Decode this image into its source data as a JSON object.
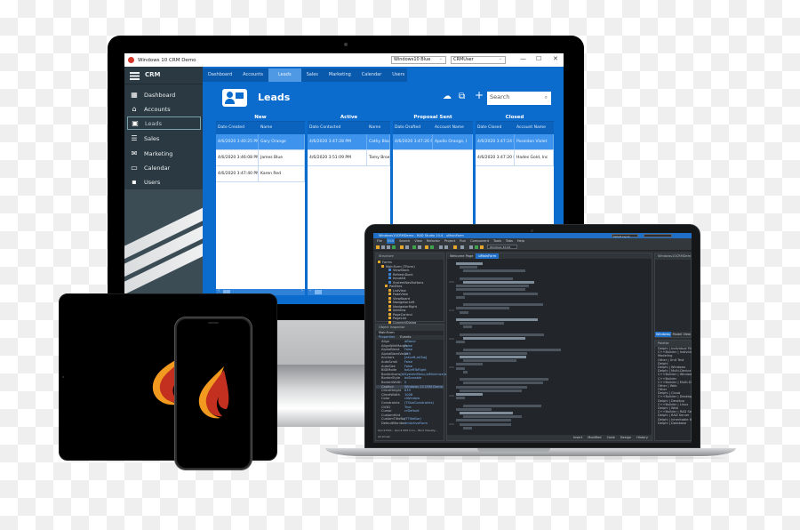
{
  "monitor": {
    "window_title": "Windows 10 CRM Demo",
    "theme_select": "Windows10 Blue",
    "user_select": "CRMUser",
    "window_controls": {
      "minimize": "—",
      "maximize": "☐",
      "close": "✕"
    },
    "sidebar": {
      "title": "CRM",
      "items": [
        {
          "label": "Dashboard",
          "icon": "dashboard-icon",
          "glyph": "▦"
        },
        {
          "label": "Accounts",
          "icon": "bank-icon",
          "glyph": "🏛"
        },
        {
          "label": "Leads",
          "icon": "contact-card-icon",
          "glyph": "▣",
          "active": true
        },
        {
          "label": "Sales",
          "icon": "list-icon",
          "glyph": "☰"
        },
        {
          "label": "Marketing",
          "icon": "envelope-icon",
          "glyph": "✉"
        },
        {
          "label": "Calendar",
          "icon": "calendar-icon",
          "glyph": "▭"
        },
        {
          "label": "Users",
          "icon": "user-badge-icon",
          "glyph": "▪"
        }
      ]
    },
    "tabs": [
      {
        "label": "Dashboard"
      },
      {
        "label": "Accounts"
      },
      {
        "label": "Leads",
        "active": true
      },
      {
        "label": "Sales"
      },
      {
        "label": "Marketing"
      },
      {
        "label": "Calendar"
      },
      {
        "label": "Users"
      }
    ],
    "page_title": "Leads",
    "toolbar": {
      "upload_glyph": "☁",
      "edit_glyph": "⧉",
      "add_glyph": "+",
      "search_placeholder": "Search",
      "search_glyph": "⌕"
    },
    "columns": [
      {
        "title": "New",
        "headers": [
          "Date Created",
          "Name"
        ],
        "rows": [
          [
            "4/6/2020 3:40:25 PM",
            "Gary Orange"
          ],
          [
            "4/6/2020 3:46:08 PM",
            "James Blue"
          ],
          [
            "4/6/2020 3:47:40 PM",
            "Karen Red"
          ]
        ],
        "selected_row": 0
      },
      {
        "title": "Active",
        "headers": [
          "Date Contacted",
          "Name"
        ],
        "rows": [
          [
            "4/6/2020 3:47:28 PM",
            "Cathy Blac"
          ],
          [
            "4/6/2020 3:51:09 PM",
            "Tamy Brow"
          ]
        ],
        "selected_row": 0
      },
      {
        "title": "Proposal Sent",
        "headers": [
          "Date Drafted",
          "Account Name"
        ],
        "rows": [
          [
            "4/6/2020 3:47:26 PM",
            "Apollo Orange, I"
          ]
        ],
        "selected_row": 0
      },
      {
        "title": "Closed",
        "headers": [
          "Date Closed",
          "Account Name"
        ],
        "rows": [
          [
            "4/6/2020 3:47:24 PM",
            "Poseidon Violet"
          ],
          [
            "4/6/2020 3:47:20 PM",
            "Hades Gold, Inc"
          ]
        ],
        "selected_row": 0
      }
    ],
    "nav": {
      "first": "⊲|",
      "prev": "◁",
      "next": "▷"
    }
  },
  "laptop": {
    "ide_title": "Windows10CRMDemo - RAD Studio 10.4 - uMainForm",
    "menu": [
      "File",
      "Edit",
      "Search",
      "View",
      "Refactor",
      "Project",
      "Run",
      "Component",
      "Tools",
      "Tabs",
      "Help"
    ],
    "layout_select": "Default Layout",
    "platform_select": "Windows 32-bit",
    "structure_title": "Structure",
    "structure_items": [
      "Forms",
      "MainForm (TForm)",
      "ViewStack",
      "RefreshDock",
      "InputAlt",
      "SystemNavButtons",
      "Palettes",
      "ListView",
      "FadeView",
      "ViewBoard",
      "NavigatorLeft",
      "NavigatorRight",
      "SetView",
      "PageControl",
      "PageList",
      "ConnectDialog",
      "Panel1",
      "Label1"
    ],
    "editor_tabs": [
      "Welcome Page",
      "uMainForm"
    ],
    "gutter_numbers": [
      "200",
      "210",
      "220",
      "230",
      "240",
      "250"
    ],
    "object_inspector": {
      "title": "Object Inspector",
      "object": "MainForm",
      "tabs": [
        "Properties",
        "Events"
      ],
      "rows": [
        {
          "key": "Align",
          "value": "alNone"
        },
        {
          "key": "AlignWithMargin",
          "value": "False"
        },
        {
          "key": "AlphaBlend",
          "value": "False"
        },
        {
          "key": "AlphaBlendValue",
          "value": "255"
        },
        {
          "key": "Anchors",
          "value": "[akLeft,akTop]"
        },
        {
          "key": "AutoScroll",
          "value": "False"
        },
        {
          "key": "AutoSize",
          "value": "False"
        },
        {
          "key": "BiDiMode",
          "value": "bdLeftToRight"
        },
        {
          "key": "BorderIcons",
          "value": "[biSystemMenu,biMinimize,biMaximize]"
        },
        {
          "key": "BorderStyle",
          "value": "bsSizeable"
        },
        {
          "key": "BorderWidth",
          "value": "0"
        },
        {
          "key": "Caption",
          "value": "Windows 10 CRM Demo",
          "selected": true
        },
        {
          "key": "ClientHeight",
          "value": "639"
        },
        {
          "key": "ClientWidth",
          "value": "1008"
        },
        {
          "key": "Color",
          "value": "clWindow"
        },
        {
          "key": "Constraints",
          "value": "(TSizeConstraints)"
        },
        {
          "key": "Ctl3D",
          "value": "True"
        },
        {
          "key": "Cursor",
          "value": "crDefault"
        },
        {
          "key": "CustomHint",
          "value": ""
        },
        {
          "key": "CustomTitleBar",
          "value": "(TTitleBar)"
        },
        {
          "key": "DefaultMonitor",
          "value": "dmActiveForm"
        }
      ],
      "footer": "Quick Edit... Quick Edit Icon... Bind Visually...",
      "status": "All shown"
    },
    "project_title": "Windows10CRMDemo.dproj",
    "project_tabs": [
      "Windows10CR...",
      "Model View"
    ],
    "palette_title": "Palette",
    "palette_items": [
      "Delphi | Individual Files",
      "C++Builder | Individual Files",
      "Modeling",
      "Other | Unit Test",
      "Delphi",
      "Delphi | Windows",
      "Delphi | Multi-Device",
      "C++Builder | Windows",
      "C++Builder",
      "C++Builder | Multi-Device",
      "Other | Web",
      "Other",
      "Delphi | Cloud",
      "C++Builder | Desktop",
      "Delphi | Desktop",
      "C++Builder | Linux",
      "Delphi | Web",
      "C++Builder | RAD Server",
      "Delphi | RAD Server",
      "Delphi | Inheritable Items",
      "Delphi | Database"
    ],
    "editor_status": [
      "Insert",
      "Modified",
      "Code",
      "Design",
      "History"
    ]
  },
  "mobile": {
    "tablet_logo": "flame-logo",
    "phone_logo": "flame-logo",
    "flame_colors": {
      "outer": "#f29a1f",
      "inner": "#c3301f"
    }
  }
}
